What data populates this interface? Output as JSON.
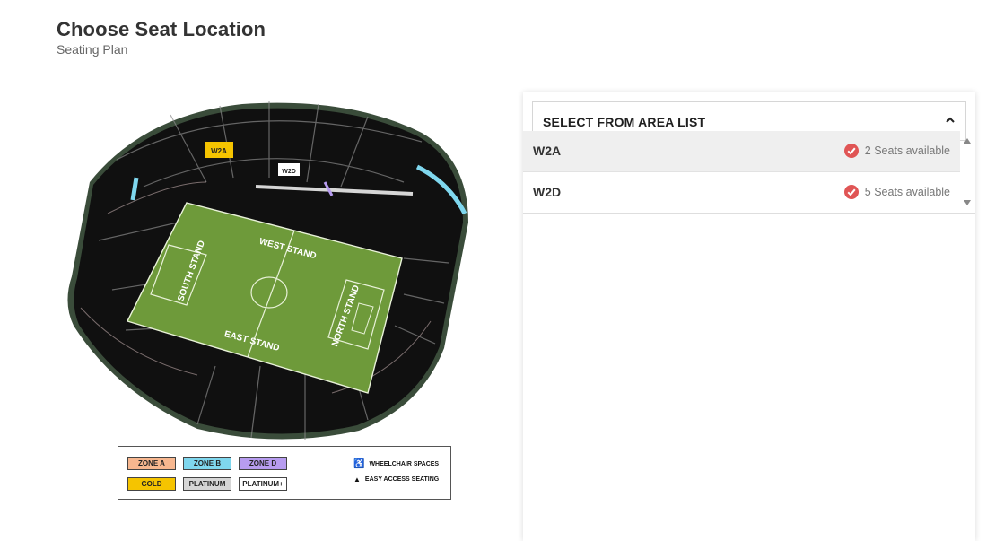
{
  "page": {
    "title": "Choose Seat Location",
    "subtitle": "Seating Plan"
  },
  "stadium_map": {
    "stand_labels": [
      "WEST STAND",
      "SOUTH STAND",
      "NORTH STAND",
      "EAST STAND"
    ],
    "section_tags": [
      "W2A",
      "W2D"
    ],
    "pitch_color": "#6e9a3a",
    "seat_block_color": "#0c0c0c"
  },
  "legend": {
    "zones": [
      {
        "label": "ZONE A",
        "color": "#f7b78f"
      },
      {
        "label": "ZONE B",
        "color": "#7fd7ee"
      },
      {
        "label": "ZONE D",
        "color": "#b79cf0"
      },
      {
        "label": "GOLD",
        "color": "#f5c400"
      },
      {
        "label": "PLATINUM",
        "color": "#d6d6d6"
      },
      {
        "label": "PLATINUM+",
        "color": "#ffffff"
      }
    ],
    "notes": [
      {
        "label": "WHEELCHAIR SPACES",
        "icon": "wheelchair-icon",
        "glyph": "♿"
      },
      {
        "label": "EASY ACCESS SEATING",
        "icon": "triangle-icon",
        "glyph": "▲"
      }
    ]
  },
  "area_panel": {
    "header": "SELECT FROM AREA LIST",
    "header_icon": "chevron-up-icon",
    "items": [
      {
        "name": "W2A",
        "availability": "2 Seats available",
        "icon": "check-circle-icon",
        "highlighted": true
      },
      {
        "name": "W2D",
        "availability": "5 Seats available",
        "icon": "check-circle-icon",
        "highlighted": false
      }
    ],
    "status_color": "#e05555"
  }
}
